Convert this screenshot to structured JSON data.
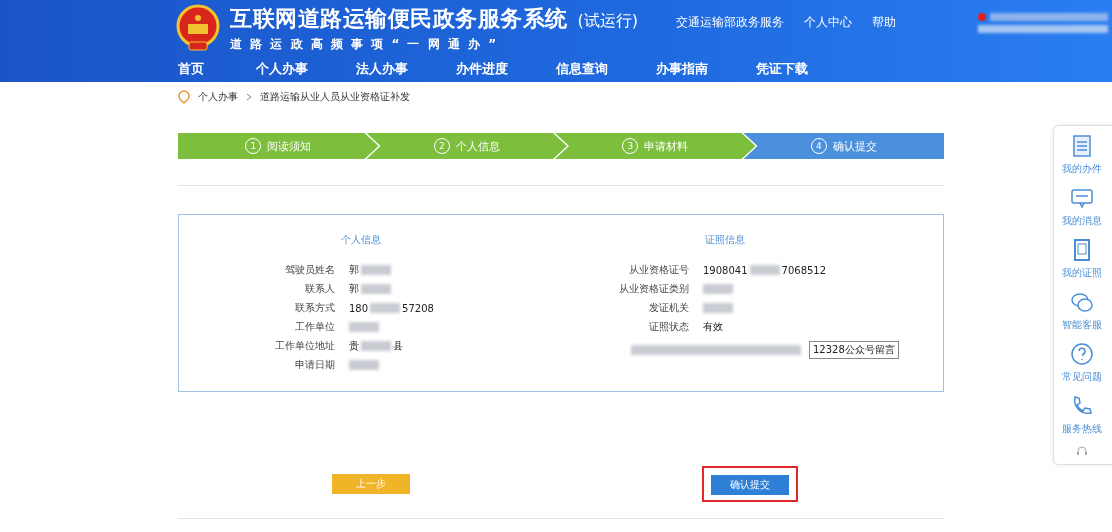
{
  "header": {
    "title": "互联网道路运输便民政务服务系统",
    "badge": "(试运行)",
    "slogan": "道 路 运 政 高 频 事 项 “ 一 网 通 办 ”",
    "links": [
      {
        "label": "交通运输部政务服务"
      },
      {
        "label": "个人中心"
      },
      {
        "label": "帮助"
      }
    ]
  },
  "nav": [
    {
      "label": "首页",
      "selected": false
    },
    {
      "label": "个人办事",
      "selected": false
    },
    {
      "label": "法人办事",
      "selected": false
    },
    {
      "label": "办件进度",
      "selected": false
    },
    {
      "label": "信息查询",
      "selected": false
    },
    {
      "label": "办事指南",
      "selected": false
    },
    {
      "label": "凭证下载",
      "selected": false
    }
  ],
  "breadcrumb": [
    "个人办事",
    "道路运输从业人员从业资格证补发"
  ],
  "steps": [
    {
      "number": "1",
      "label": "阅读须知",
      "selected": false
    },
    {
      "number": "2",
      "label": "个人信息",
      "selected": false
    },
    {
      "number": "3",
      "label": "申请材料",
      "selected": false
    },
    {
      "number": "4",
      "label": "确认提交",
      "selected": true
    }
  ],
  "personal": {
    "heading": "个人信息",
    "rows": [
      {
        "label": "驾驶员姓名",
        "value": "郭",
        "redacted": true
      },
      {
        "label": "联系人",
        "value": "郭",
        "redacted": true
      },
      {
        "label": "联系方式",
        "value": "180",
        "tail": "57208",
        "redacted": true
      },
      {
        "label": "工作单位",
        "redacted": true
      },
      {
        "label": "工作单位地址",
        "value": "贵",
        "tail": "县",
        "redacted": true
      },
      {
        "label": "申请日期",
        "redacted": true
      }
    ]
  },
  "license": {
    "heading": "证照信息",
    "rows": [
      {
        "label": "从业资格证号",
        "value": "1908041",
        "tail": "7068512",
        "redacted": true
      },
      {
        "label": "从业资格证类别",
        "redacted": true
      },
      {
        "label": "发证机关",
        "redacted": true
      },
      {
        "label": "证照状态",
        "value": "有效",
        "redacted": false
      }
    ],
    "note": "12328公众号留言"
  },
  "buttons": [
    {
      "label": "上一步",
      "kind": "back"
    },
    {
      "label": "确认提交",
      "kind": "submit",
      "highlighted": true
    }
  ],
  "sidebar": [
    {
      "label": "我的办件"
    },
    {
      "label": "我的消息"
    },
    {
      "label": "我的证照"
    },
    {
      "label": "智能客服"
    },
    {
      "label": "常见问题"
    },
    {
      "label": "服务热线"
    }
  ]
}
